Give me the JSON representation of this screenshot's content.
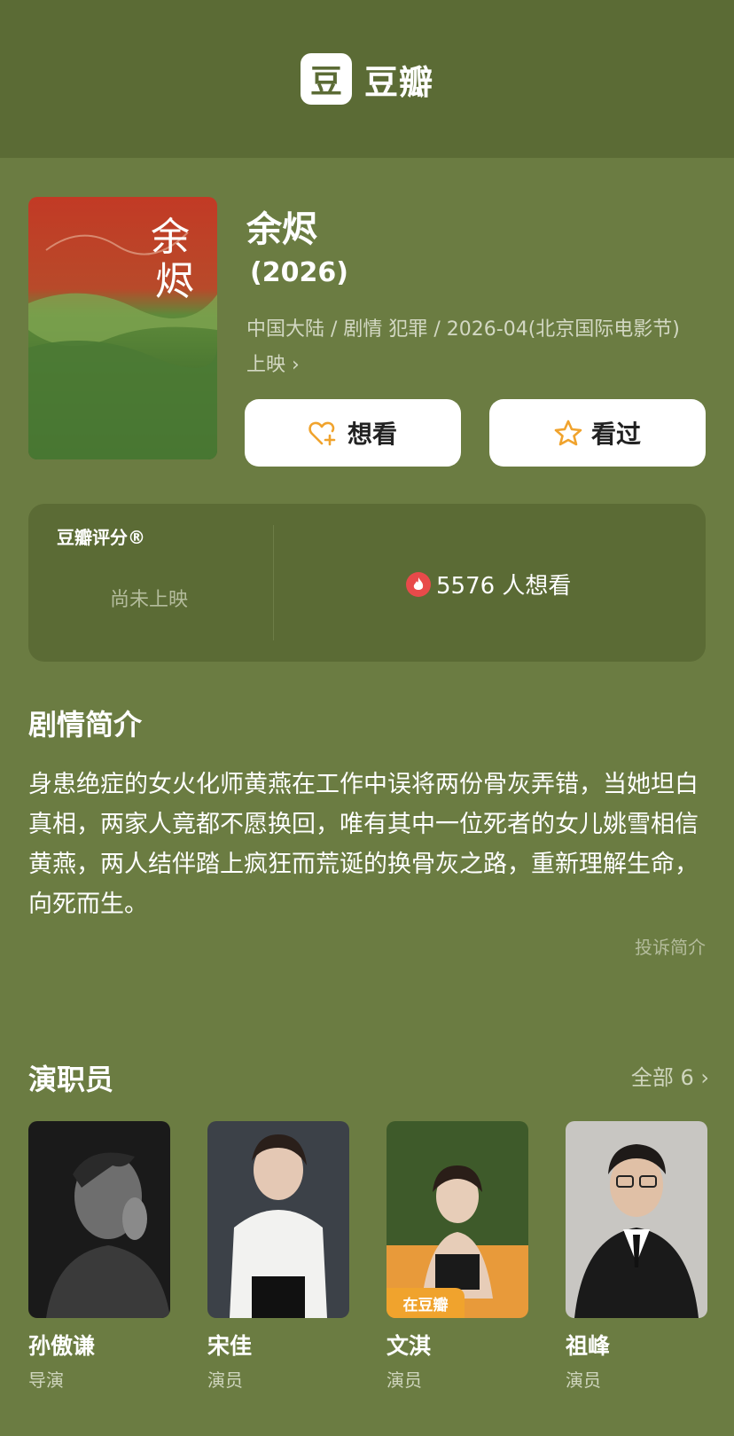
{
  "header": {
    "logo_char": "豆",
    "logo_text": "豆瓣"
  },
  "movie": {
    "title": "余烬",
    "year": "(2026)",
    "meta": "中国大陆 / 剧情 犯罪 / 2026-04(北京国际电影节) 上映",
    "poster_title": "余烬"
  },
  "actions": {
    "want": "想看",
    "seen": "看过"
  },
  "rating": {
    "label": "豆瓣评分®",
    "status": "尚未上映",
    "want_count": "5576 人想看"
  },
  "synopsis": {
    "heading": "剧情简介",
    "text": "身患绝症的女火化师黄燕在工作中误将两份骨灰弄错，当她坦白真相，两家人竟都不愿换回，唯有其中一位死者的女儿姚雪相信黄燕，两人结伴踏上疯狂而荒诞的换骨灰之路，重新理解生命，向死而生。",
    "report": "投诉简介"
  },
  "cast": {
    "heading": "演职员",
    "all_label": "全部 6",
    "members": [
      {
        "name": "孙傲谦",
        "role": "导演"
      },
      {
        "name": "宋佳",
        "role": "演员"
      },
      {
        "name": "文淇",
        "role": "演员",
        "badge": "在豆瓣"
      },
      {
        "name": "祖峰",
        "role": "演员"
      }
    ]
  },
  "colors": {
    "background": "#6b7c42",
    "header": "#5b6b35",
    "accent": "#f0a32d",
    "heart": "#e84a4a"
  }
}
